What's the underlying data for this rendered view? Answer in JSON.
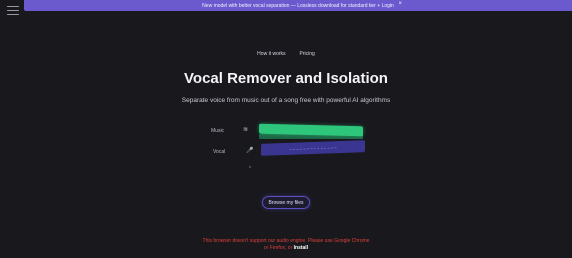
{
  "banner": {
    "text": "New model with better vocal separation — Lossless download for standard tier + Login",
    "close": "×"
  },
  "nav": {
    "items": [
      "How it works",
      "Pricing"
    ]
  },
  "hero": {
    "title": "Vocal Remover and Isolation",
    "subtitle": "Separate voice from music out of a song free with powerful AI algorithms"
  },
  "tracks": {
    "music_label": "Music",
    "vocal_label": "Vocal",
    "music_icon": "waveform-icon",
    "vocal_icon": "microphone-icon",
    "vocal_bar_text": "~ ~ ~ ~ ~ ~ ~ ~ ~ ~ ~ ~ ~ ~"
  },
  "actions": {
    "choose_file": "Browse my files"
  },
  "warning": {
    "line1": "This browser doesn't support our audio engine. Please use Google Chrome",
    "line2_prefix": "or Firefox, or",
    "line2_link": "Install"
  },
  "colors": {
    "background": "#18181d",
    "accent": "#6a5acd",
    "music_bar": "#2ec67a",
    "vocal_bar": "#3b3592",
    "warning": "#e0413a"
  }
}
